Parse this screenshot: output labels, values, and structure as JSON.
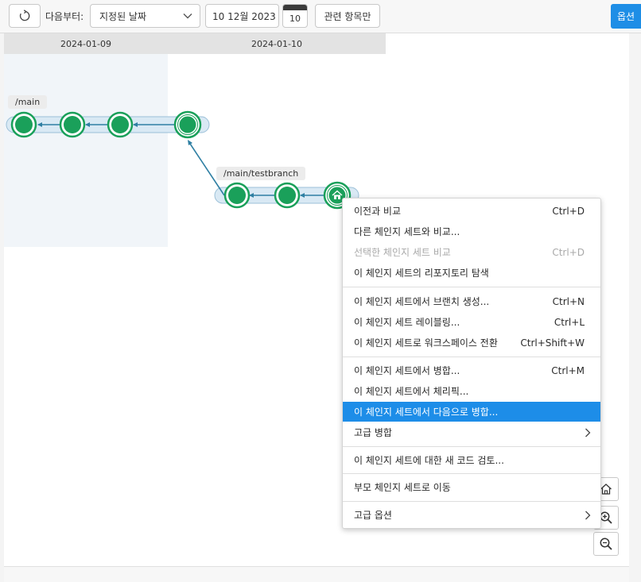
{
  "toolbar": {
    "from_label": "다음부터:",
    "date_mode": "지정된 날짜",
    "date_value": "10 12월 2023",
    "calendar_day": "10",
    "related_label": "관련 항목만",
    "options_label": "옵션"
  },
  "graph": {
    "dates": [
      "2024-01-09",
      "2024-01-10"
    ],
    "branches": [
      {
        "label": "/main",
        "commit_count": 4
      },
      {
        "label": "/main/testbranch",
        "commit_count": 3
      }
    ],
    "colors": {
      "commit": "#1aa05a",
      "commit_ring": "#1aa05a",
      "branch_band": "#d9e9f4",
      "link": "#2f7fa3"
    }
  },
  "context_menu": {
    "items": [
      {
        "label": "이전과 비교",
        "shortcut": "Ctrl+D"
      },
      {
        "label": "다른 체인지 세트와 비교...",
        "shortcut": ""
      },
      {
        "label": "선택한 체인지 세트 비교",
        "shortcut": "Ctrl+D",
        "disabled": true
      },
      {
        "label": "이 체인지 세트의 리포지토리 탐색",
        "shortcut": ""
      },
      {
        "label": "이 체인지 세트에서 브랜치 생성...",
        "shortcut": "Ctrl+N"
      },
      {
        "label": "이 체인지 세트 레이블링...",
        "shortcut": "Ctrl+L"
      },
      {
        "label": "이 체인지 세트로 워크스페이스 전환",
        "shortcut": "Ctrl+Shift+W"
      },
      {
        "label": "이 체인지 세트에서 병합...",
        "shortcut": "Ctrl+M"
      },
      {
        "label": "이 체인지 세트에서 체리픽...",
        "shortcut": ""
      },
      {
        "label": "이 체인지 세트에서 다음으로 병합...",
        "shortcut": "",
        "highlighted": true
      },
      {
        "label": "고급 병합",
        "shortcut": "",
        "submenu": true
      },
      {
        "label": "이 체인지 세트에 대한 새 코드 검토...",
        "shortcut": ""
      },
      {
        "label": "부모 체인지 세트로 이동",
        "shortcut": ""
      },
      {
        "label": "고급 옵션",
        "shortcut": "",
        "submenu": true
      }
    ]
  },
  "icons": [
    "refresh-icon",
    "chevron-down-icon",
    "calendar-icon",
    "home-icon",
    "zoom-in-icon",
    "zoom-out-icon",
    "chevron-right-icon"
  ]
}
